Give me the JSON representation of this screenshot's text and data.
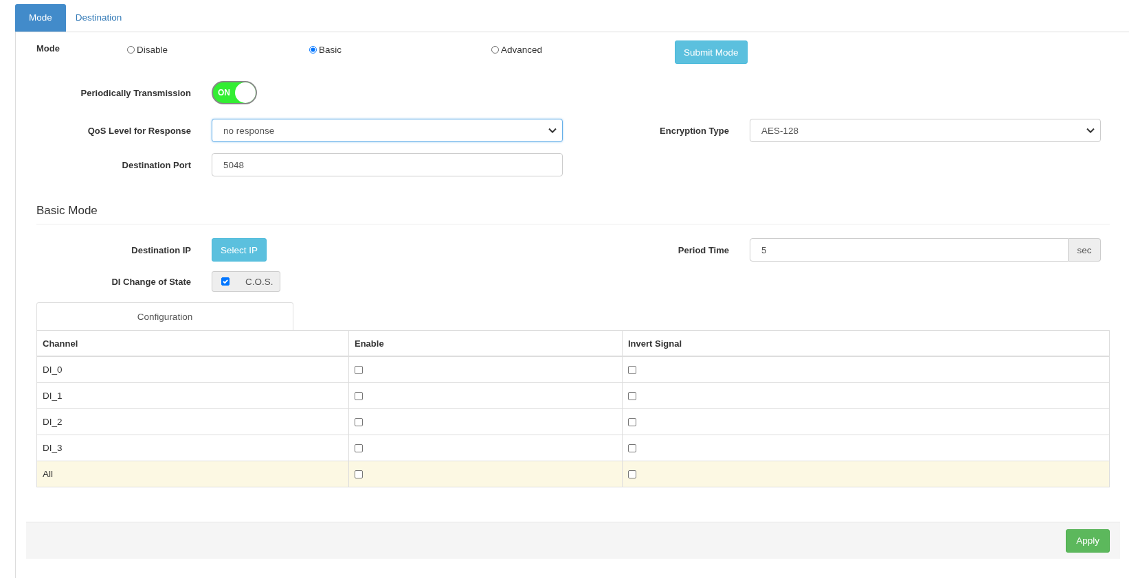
{
  "tabs": [
    {
      "label": "Mode",
      "selected": true
    },
    {
      "label": "Destination",
      "selected": false
    }
  ],
  "mode": {
    "label": "Mode",
    "options": [
      {
        "label": "Disable",
        "selected": false
      },
      {
        "label": "Basic",
        "selected": true
      },
      {
        "label": "Advanced",
        "selected": false
      }
    ],
    "submit": "Submit Mode"
  },
  "periodic": {
    "label": "Periodically Transmission",
    "on": true,
    "text": "ON"
  },
  "qos": {
    "label": "QoS Level for Response",
    "value": "no response"
  },
  "encryption": {
    "label": "Encryption Type",
    "value": "AES-128"
  },
  "port": {
    "label": "Destination Port",
    "value": "5048"
  },
  "basic_mode": {
    "title": "Basic Mode",
    "destination_ip": {
      "label": "Destination IP",
      "button": "Select IP"
    },
    "period_time": {
      "label": "Period Time",
      "value": "5",
      "unit": "sec"
    },
    "di_change": {
      "label": "DI Change of State",
      "checked": true,
      "text": "C.O.S."
    }
  },
  "configuration": {
    "tab": "Configuration",
    "columns": [
      "Channel",
      "Enable",
      "Invert Signal"
    ],
    "rows": [
      {
        "kind": "channel",
        "channel": "DI_0",
        "enable": false,
        "invert": false
      },
      {
        "kind": "channel",
        "channel": "DI_1",
        "enable": false,
        "invert": false
      },
      {
        "kind": "channel",
        "channel": "DI_2",
        "enable": false,
        "invert": false
      },
      {
        "kind": "channel",
        "channel": "DI_3",
        "enable": false,
        "invert": false
      },
      {
        "kind": "all",
        "channel": "All",
        "enable": false,
        "invert": false
      }
    ]
  },
  "footer": {
    "apply": "Apply"
  }
}
